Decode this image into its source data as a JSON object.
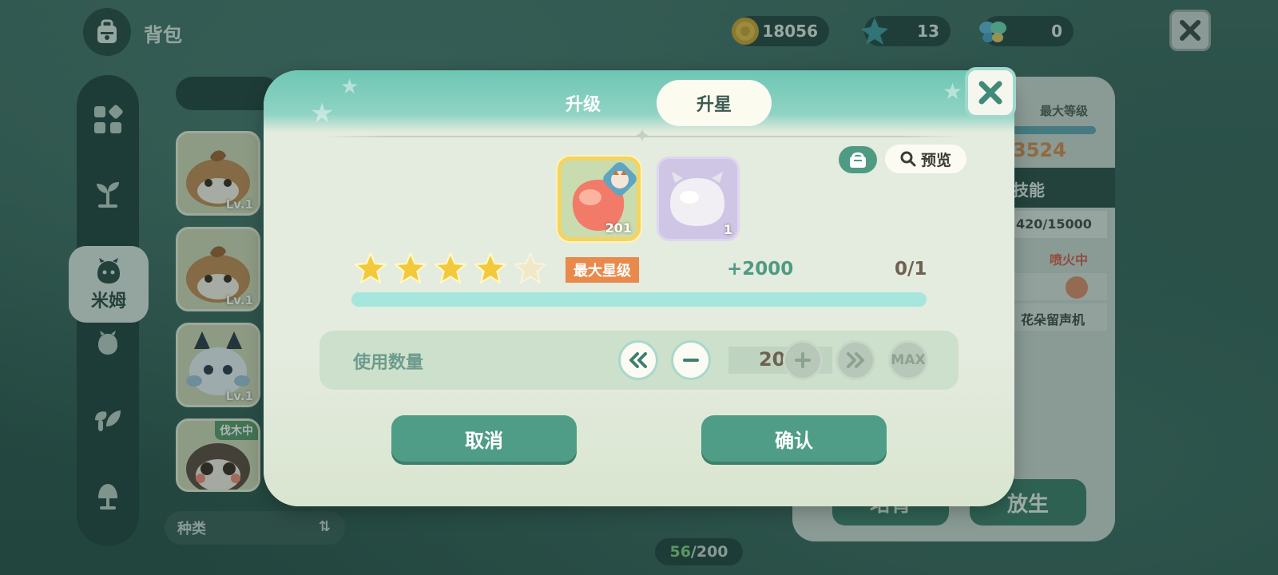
{
  "header": {
    "title": "背包",
    "coins": "18056",
    "gems": "13",
    "butterflies": "0"
  },
  "sidenav": {
    "active_label": "米姆"
  },
  "creature_list": {
    "cards": [
      {
        "level": "Lv.1",
        "tag": ""
      },
      {
        "level": "Lv.1",
        "tag": ""
      },
      {
        "level": "Lv.1",
        "tag": ""
      },
      {
        "level": "",
        "tag": "伐木中"
      }
    ],
    "sort_label": "种类",
    "count_current": "56",
    "count_total": "/200"
  },
  "detail_panel": {
    "max_level_label": "最大等级",
    "power": "3524",
    "skill_header": "技能",
    "exp": "420/15000",
    "status": "喷火中",
    "item_name": "花朵留声机",
    "cultivate_label": "培育",
    "release_label": "放生"
  },
  "modal": {
    "tab_upgrade": "升级",
    "tab_star": "升星",
    "preview_label": "预览",
    "main_item_count": "201",
    "second_item_count": "1",
    "star_count_filled": 4,
    "star_total": 5,
    "max_star_badge": "最大星级",
    "gain": "+2000",
    "ratio": "0/1",
    "progress_fraction": 1.0,
    "quantity_label": "使用数量",
    "quantity_value": "200",
    "max_label": "MAX",
    "cancel_label": "取消",
    "confirm_label": "确认"
  },
  "colors": {
    "accent": "#4f9d86",
    "badge_orange": "#e98a4c",
    "star_gold": "#f2c93a",
    "progress": "#a6e6dc"
  }
}
